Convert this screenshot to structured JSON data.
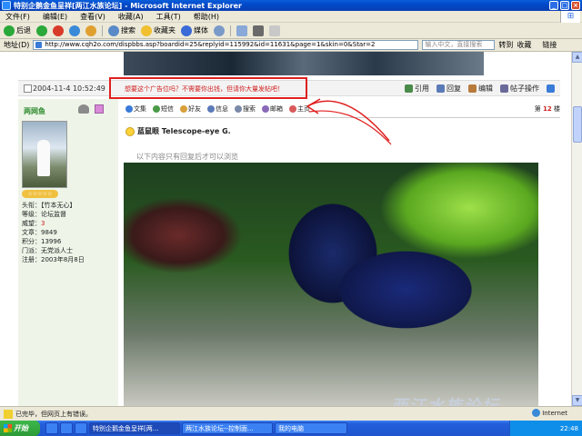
{
  "window": {
    "title": "特别企鹅金鱼呈祥[两江水族论坛] - Microsoft Internet Explorer"
  },
  "menu": [
    "文件(F)",
    "编辑(E)",
    "查看(V)",
    "收藏(A)",
    "工具(T)",
    "帮助(H)"
  ],
  "toolbar": {
    "back": "后退",
    "search": "搜索",
    "favorites": "收藏夹",
    "media": "媒体"
  },
  "address": {
    "label": "地址(D)",
    "url": "http://www.cqh2o.com/dispbbs.asp?boardid=25&replyid=115992&id=11631&page=1&skin=0&Star=2",
    "search_placeholder": "输入中文，直接搜索",
    "go": "转到",
    "favorites": "收藏",
    "bar_label": "链接"
  },
  "post": {
    "date": "2004-11-4 10:52:49",
    "ad_text": "想要这个广告位吗？不需要你出钱，但请你大量发帖吧！",
    "actions": [
      "引用",
      "回复",
      "编辑",
      "帖子操作"
    ],
    "user_tools": [
      "文集",
      "短信",
      "好友",
      "信息",
      "搜索",
      "邮箱",
      "主页"
    ],
    "floor_prefix": "第",
    "floor_number": "12",
    "floor_suffix": "楼",
    "title": "蓝鼠眼 Telescope-eye G.",
    "reply_note": "以下内容只有回复后才可以浏览"
  },
  "user": {
    "name": "两网鱼",
    "rank_stars": "☆☆☆☆☆",
    "info": [
      {
        "label": "头衔：",
        "value": "【竹本无心】"
      },
      {
        "label": "等级：",
        "value": "论坛监督"
      },
      {
        "label": "威望：",
        "value": "3"
      },
      {
        "label": "文章：",
        "value": "9849"
      },
      {
        "label": "积分：",
        "value": "13996"
      },
      {
        "label": "门派：",
        "value": "无党派人士"
      },
      {
        "label": "注册：",
        "value": "2003年8月8日"
      }
    ]
  },
  "watermark": "两江水族论坛",
  "statusbar": {
    "text": "已完毕，但网页上有错误。",
    "zone": "Internet"
  },
  "taskbar": {
    "start": "开始",
    "tasks": [
      "特别企鹅金鱼呈祥[两...",
      "两江水族论坛--控制面...",
      "我的电脑"
    ],
    "clock": "22:48"
  },
  "colors": {
    "ad_red": "#d02020",
    "username_green": "#2e8b2e",
    "titlebar_blue": "#0049c9"
  }
}
